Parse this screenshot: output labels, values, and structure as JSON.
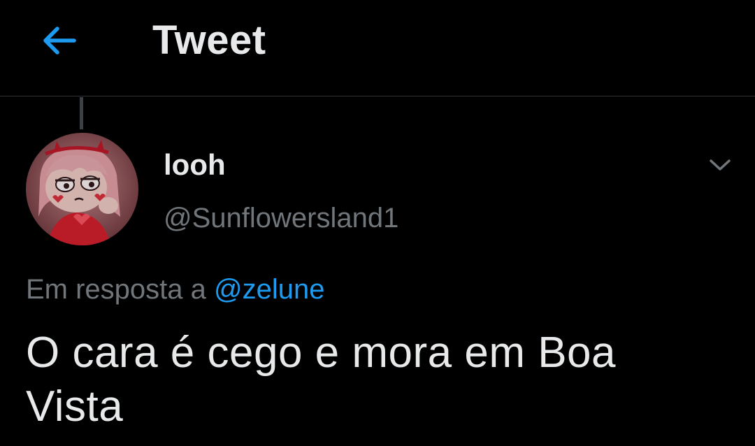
{
  "colors": {
    "background": "#000000",
    "text_primary": "#e7e9ea",
    "text_secondary": "#71767b",
    "accent": "#1d9bf0",
    "divider": "#2f3336"
  },
  "header": {
    "back_icon": "arrow-left-icon",
    "title": "Tweet"
  },
  "tweet": {
    "author": {
      "display_name": "looh",
      "handle": "@Sunflowersland1",
      "avatar_icon": "avatar-image"
    },
    "more_icon": "chevron-down-icon",
    "reply_prefix": "Em resposta a",
    "reply_to": "@zelune",
    "text": "O cara é cego e mora em Boa Vista"
  }
}
